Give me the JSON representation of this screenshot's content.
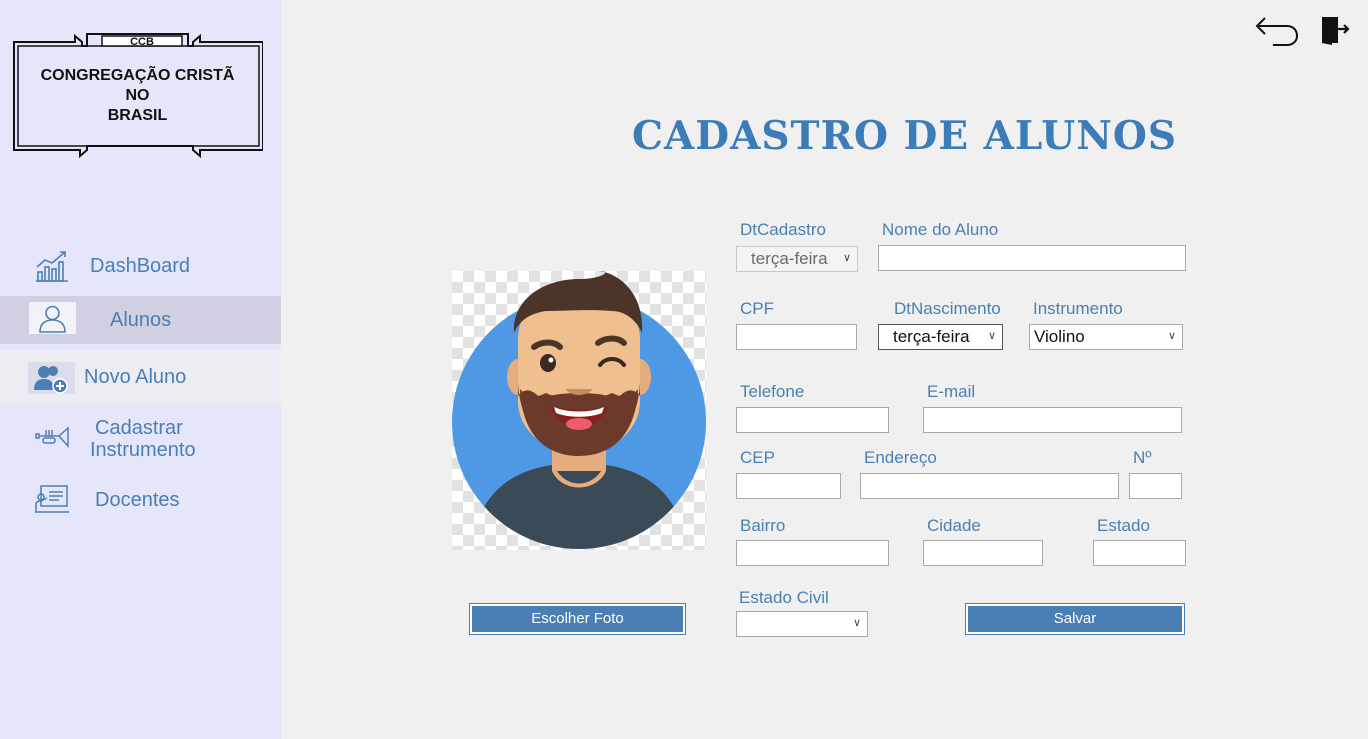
{
  "logo": {
    "abbr": "CCB",
    "lines": [
      "CONGREGAÇÃO CRISTÃ",
      "NO",
      "BRASIL"
    ]
  },
  "sidebar": {
    "items": [
      {
        "label": "DashBoard",
        "icon": "chart-bars-icon"
      },
      {
        "label": "Alunos",
        "icon": "user-outline-icon",
        "state": "active"
      },
      {
        "label": "Novo Aluno",
        "icon": "add-user-icon",
        "state": "hover"
      },
      {
        "label": "Cadastrar",
        "label2": "Instrumento",
        "icon": "trumpet-icon"
      },
      {
        "label": "Docentes",
        "icon": "teacher-board-icon"
      }
    ]
  },
  "header": {
    "title": "CADASTRO DE ALUNOS",
    "icons": [
      "back-arrow-icon",
      "exit-door-icon"
    ]
  },
  "form": {
    "dt_cadastro": {
      "label": "DtCadastro",
      "value": "terça-feira"
    },
    "nome": {
      "label": "Nome do Aluno",
      "value": ""
    },
    "cpf": {
      "label": "CPF",
      "value": ""
    },
    "dt_nascimento": {
      "label": "DtNascimento",
      "value": "terça-feira"
    },
    "instrumento": {
      "label": "Instrumento",
      "value": "Violino"
    },
    "telefone": {
      "label": "Telefone",
      "value": ""
    },
    "email": {
      "label": "E-mail",
      "value": ""
    },
    "cep": {
      "label": "CEP",
      "value": ""
    },
    "endereco": {
      "label": "Endereço",
      "value": ""
    },
    "numero": {
      "label": "Nº",
      "value": ""
    },
    "bairro": {
      "label": "Bairro",
      "value": ""
    },
    "cidade": {
      "label": "Cidade",
      "value": ""
    },
    "estado": {
      "label": "Estado",
      "value": ""
    },
    "estado_civil": {
      "label": "Estado Civil",
      "value": ""
    }
  },
  "buttons": {
    "escolher_foto": "Escolher Foto",
    "salvar": "Salvar"
  },
  "colors": {
    "accent": "#4a7fb5",
    "title": "#3c7cb8",
    "sidebar_bg": "#e6e6fa",
    "sidebar_active": "#d0d0e2"
  }
}
